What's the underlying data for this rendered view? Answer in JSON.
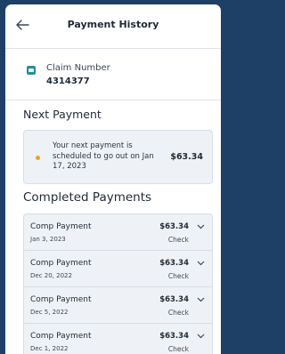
{
  "header": {
    "title": "Payment History",
    "back_icon": "arrow-left-icon"
  },
  "claim": {
    "label": "Claim Number",
    "number": "4314377",
    "icon": "document-icon"
  },
  "next_payment": {
    "section_title": "Next Payment",
    "message": "Your next payment is scheduled to go out on Jan 17, 2023",
    "amount": "$63.34",
    "status_color": "#f0a020"
  },
  "completed": {
    "section_title": "Completed Payments",
    "items": [
      {
        "name": "Comp Payment",
        "date": "Jan 3, 2023",
        "amount": "$63.34",
        "method": "Check"
      },
      {
        "name": "Comp Payment",
        "date": "Dec 20, 2022",
        "amount": "$63.34",
        "method": "Check"
      },
      {
        "name": "Comp Payment",
        "date": "Dec 5, 2022",
        "amount": "$63.34",
        "method": "Check"
      },
      {
        "name": "Comp Payment",
        "date": "Dec 1, 2022",
        "amount": "$63.34",
        "method": "Check"
      }
    ]
  }
}
